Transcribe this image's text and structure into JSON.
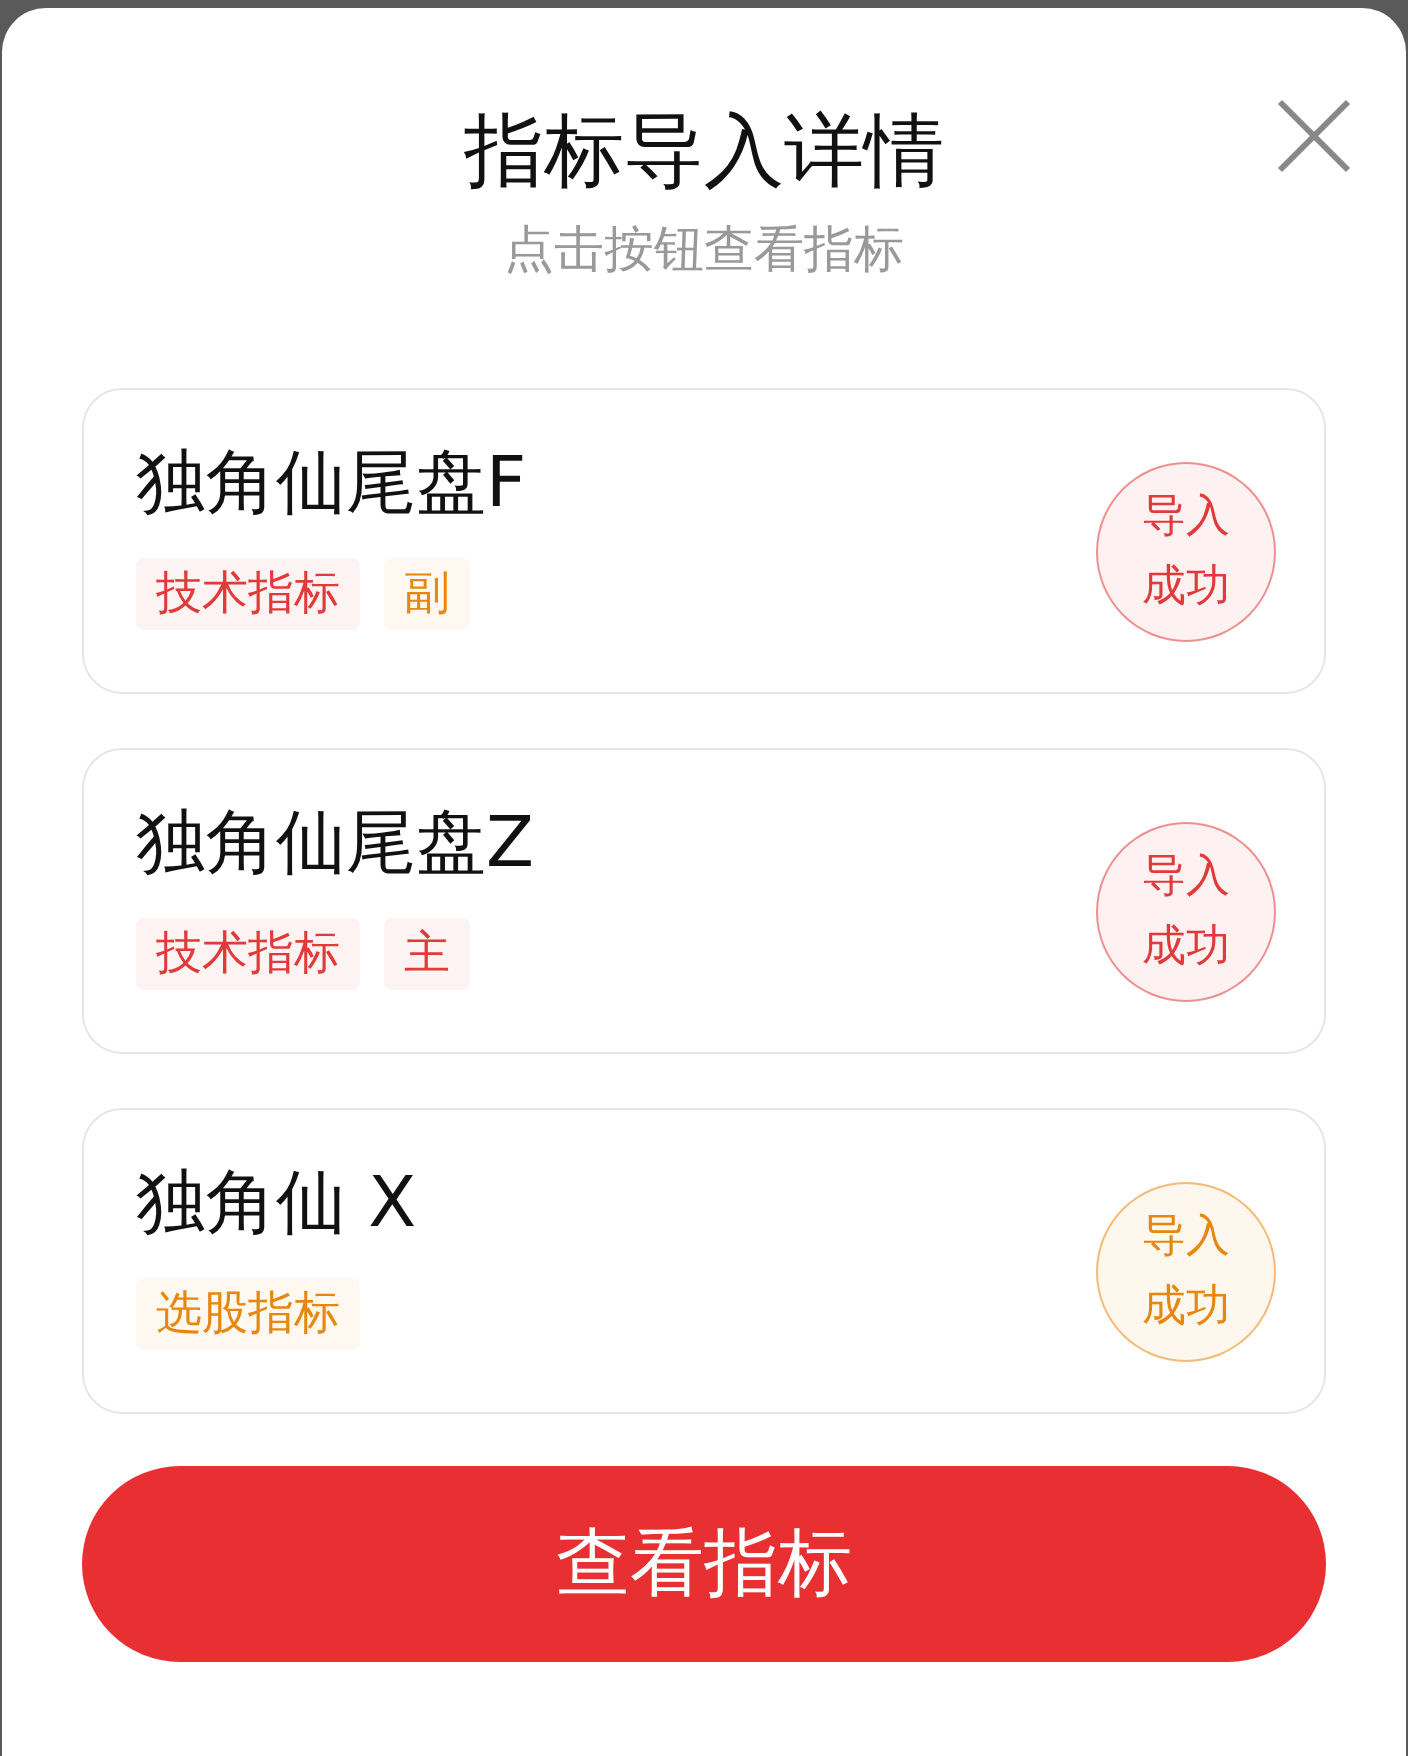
{
  "dialog": {
    "title": "指标导入详情",
    "subtitle": "点击按钮查看指标"
  },
  "items": [
    {
      "name": "独角仙尾盘F",
      "tags": [
        {
          "label": "技术指标",
          "color": "#e03a3a"
        },
        {
          "label": "副",
          "color": "#e8870f"
        }
      ],
      "status": {
        "line1": "导入",
        "line2": "成功",
        "color": "#e03a3a"
      }
    },
    {
      "name": "独角仙尾盘Z",
      "tags": [
        {
          "label": "技术指标",
          "color": "#e03a3a"
        },
        {
          "label": "主",
          "color": "#e03a3a"
        }
      ],
      "status": {
        "line1": "导入",
        "line2": "成功",
        "color": "#e03a3a"
      }
    },
    {
      "name": "独角仙 X",
      "tags": [
        {
          "label": "选股指标",
          "color": "#e8870f"
        }
      ],
      "status": {
        "line1": "导入",
        "line2": "成功",
        "color": "#e8870f"
      }
    }
  ],
  "button": {
    "label": "查看指标"
  }
}
